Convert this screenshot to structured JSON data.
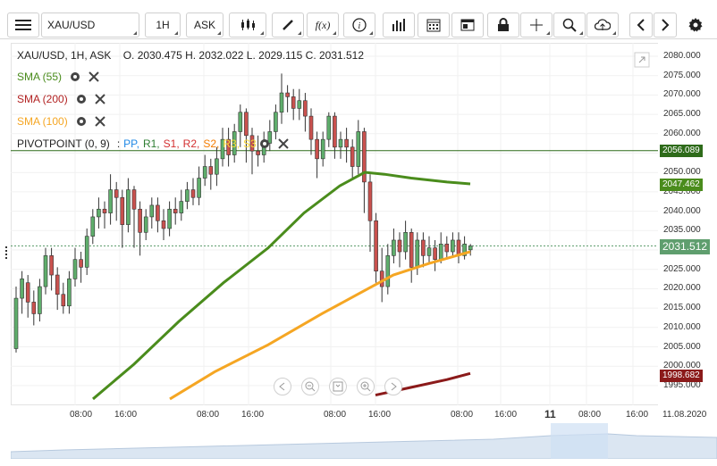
{
  "toolbar": {
    "symbol": "XAU/USD",
    "interval": "1H",
    "price_type": "ASK",
    "fx_label": "f(x)"
  },
  "legend": {
    "ohlc": "XAU/USD, 1H, ASK    O. 2030.475 H. 2032.022 L. 2029.115 C. 2031.512"
  },
  "indicators": [
    {
      "label": "SMA (55)",
      "color": "#4a8c1c"
    },
    {
      "label": "SMA (200)",
      "color": "#b22222"
    },
    {
      "label": "SMA (100)",
      "color": "#f5a623"
    }
  ],
  "pivot": {
    "label": "PIVOTPOINT (0, 9)",
    "colon": ":",
    "items": [
      {
        "text": "PP,",
        "color": "#1e88e5"
      },
      {
        "text": "R1,",
        "color": "#2e7d32"
      },
      {
        "text": "S1,",
        "color": "#d32f2f"
      },
      {
        "text": "R2,",
        "color": "#d32f2f"
      },
      {
        "text": "S2,",
        "color": "#f57c00"
      },
      {
        "text": "R3,",
        "color": "#fdd835"
      },
      {
        "text": "S3",
        "color": "#fdd835"
      }
    ]
  },
  "price_axis": [
    "2080.000",
    "2075.000",
    "2070.000",
    "2065.000",
    "2060.000",
    "2055.000",
    "2050.000",
    "2045.000",
    "2040.000",
    "2035.000",
    "2030.000",
    "2025.000",
    "2020.000",
    "2015.000",
    "2010.000",
    "2005.000",
    "2000.000",
    "1995.000"
  ],
  "price_tags": {
    "pivot": {
      "text": "2056.089",
      "color": "#2e6b1a"
    },
    "sma55": {
      "text": "2047.462",
      "color": "#4a8c1c"
    },
    "current": {
      "text": "2031.512",
      "color": "#5f9e6e"
    },
    "sma200": {
      "text": "1998.682",
      "color": "#8b1a1a"
    }
  },
  "time_axis": [
    "08:00",
    "16:00",
    "08:00",
    "16:00",
    "08:00",
    "16:00",
    "08:00",
    "16:00",
    "11",
    "08:00",
    "16:00",
    "11.08.2020"
  ],
  "colors": {
    "up": "#5fae6c",
    "down": "#c9514e",
    "sma55": "#4a8c1c",
    "sma100": "#f5a623",
    "sma200": "#8b1a1a"
  }
}
